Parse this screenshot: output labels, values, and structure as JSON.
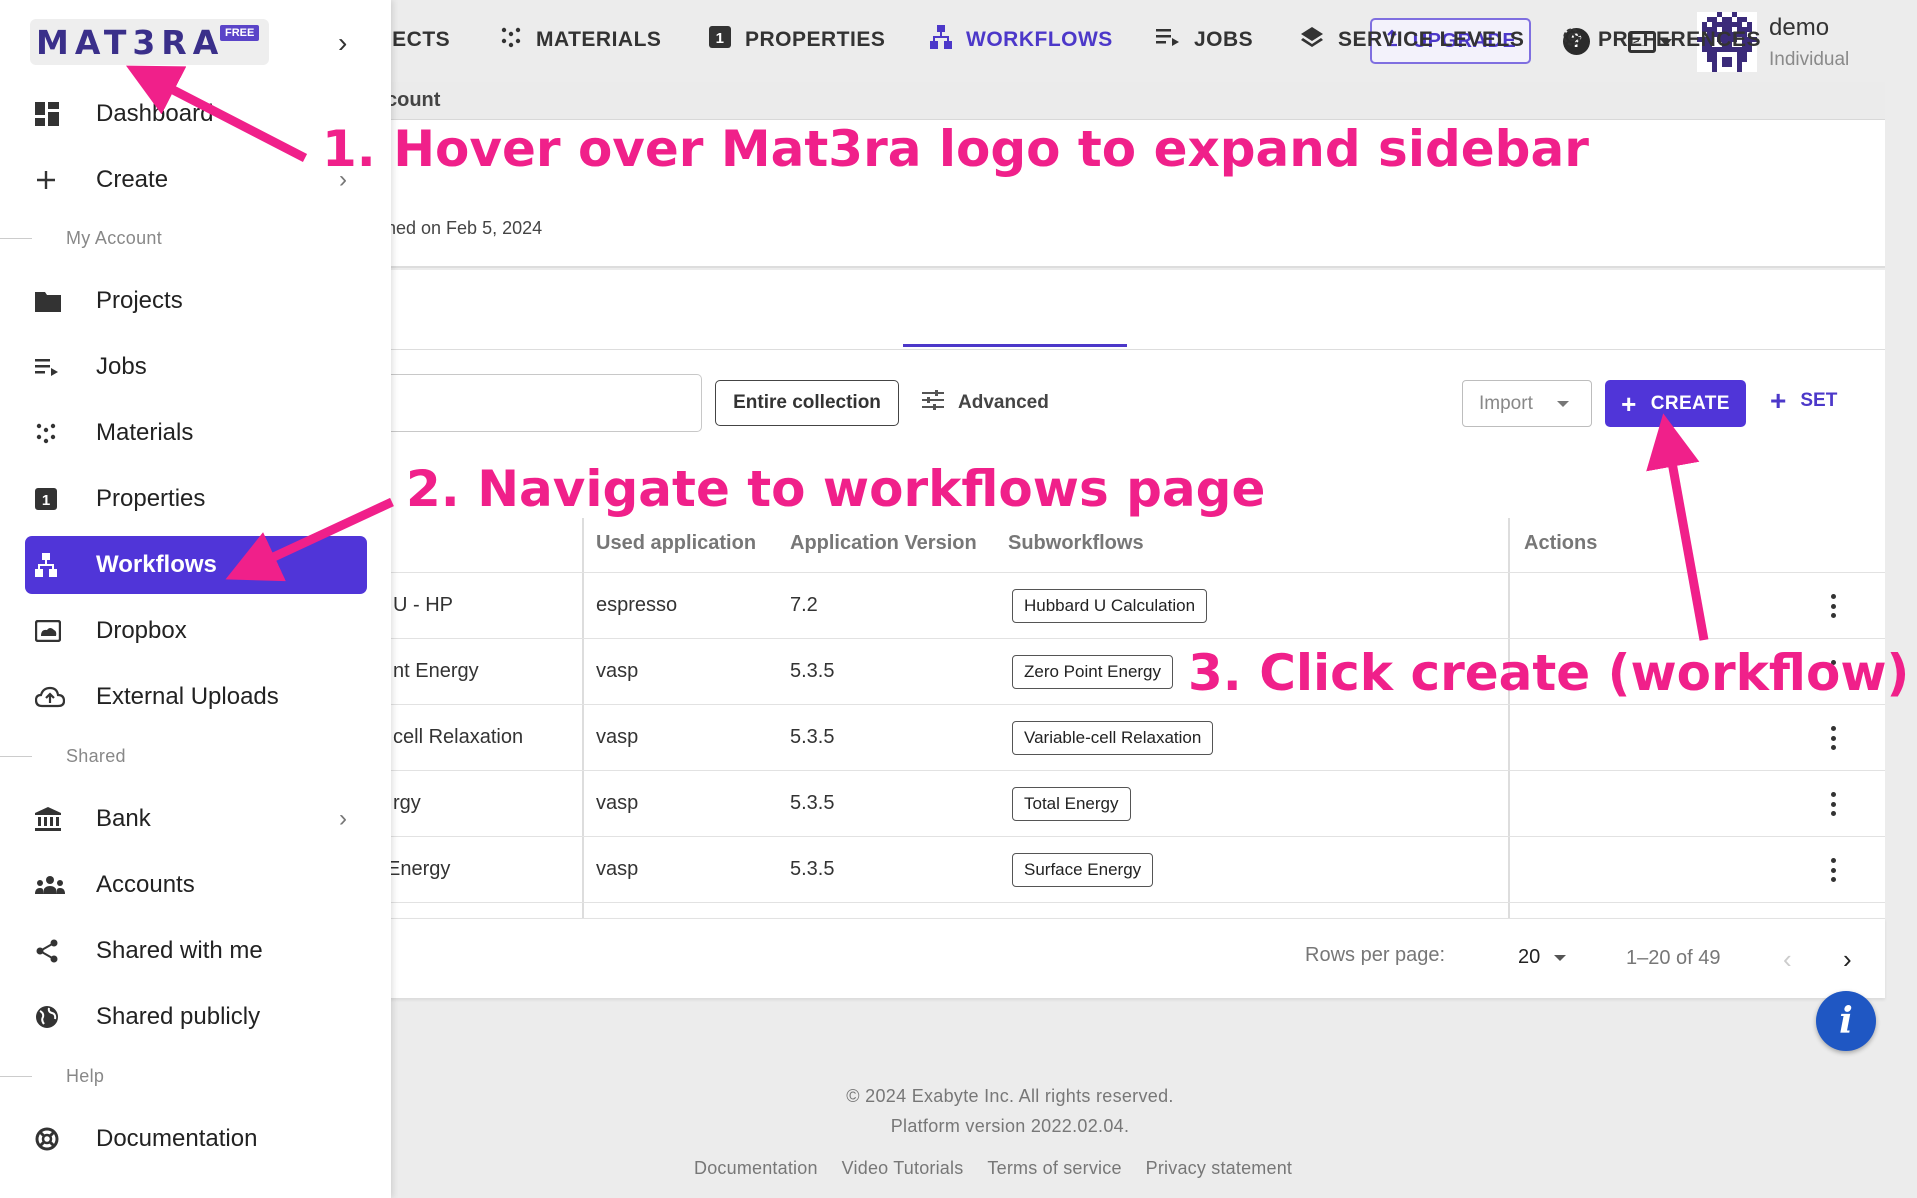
{
  "header": {
    "upgrade_label": "UPGRADE",
    "help_icon": "help-circle-icon",
    "user_name": "demo",
    "user_plan": "Individual"
  },
  "account": {
    "breadcrumb": "count",
    "joined": "ned on Feb 5, 2024"
  },
  "tabs": [
    {
      "label": "JECTS",
      "icon": "folder-icon"
    },
    {
      "label": "MATERIALS",
      "icon": "materials-icon"
    },
    {
      "label": "PROPERTIES",
      "icon": "properties-icon"
    },
    {
      "label": "WORKFLOWS",
      "icon": "workflows-icon",
      "active": true
    },
    {
      "label": "JOBS",
      "icon": "jobs-icon"
    },
    {
      "label": "SERVICE LEVELS",
      "icon": "layers-icon"
    },
    {
      "label": "PREFERENCES",
      "icon": "gear-icon"
    }
  ],
  "toolbar": {
    "search_value": "",
    "entire_collection": "Entire collection",
    "advanced": "Advanced",
    "import": "Import",
    "create": "CREATE",
    "set": "SET"
  },
  "table": {
    "columns": [
      "Used application",
      "Application Version",
      "Subworkflows",
      "Actions"
    ],
    "rows": [
      {
        "name": "U - HP",
        "app": "espresso",
        "version": "7.2",
        "sub": "Hubbard U Calculation"
      },
      {
        "name": "nt Energy",
        "app": "vasp",
        "version": "5.3.5",
        "sub": "Zero Point Energy"
      },
      {
        "name": "cell Relaxation",
        "app": "vasp",
        "version": "5.3.5",
        "sub": "Variable-cell Relaxation"
      },
      {
        "name": "rgy",
        "app": "vasp",
        "version": "5.3.5",
        "sub": "Total Energy"
      },
      {
        "name": "Energy",
        "app": "vasp",
        "version": "5.3.5",
        "sub": "Surface Energy"
      }
    ]
  },
  "pagination": {
    "rows_per_page_label": "Rows per page:",
    "rows_per_page": "20",
    "range": "1–20 of 49"
  },
  "footer": {
    "copyright": "© 2024 Exabyte Inc. All rights reserved.",
    "version": "Platform version 2022.02.04.",
    "links": [
      "Documentation",
      "Video Tutorials",
      "Terms of service",
      "Privacy statement"
    ]
  },
  "sidebar": {
    "logo": "MAT3RA",
    "badge": "FREE",
    "items": [
      {
        "label": "Dashboard",
        "icon": "dashboard-icon"
      },
      {
        "label": "Create",
        "icon": "plus-icon",
        "chevron": true
      }
    ],
    "sections": {
      "account": "My Account",
      "shared": "Shared",
      "help": "Help"
    },
    "account_items": [
      {
        "label": "Projects",
        "icon": "folder-icon"
      },
      {
        "label": "Jobs",
        "icon": "jobs-icon"
      },
      {
        "label": "Materials",
        "icon": "materials-icon"
      },
      {
        "label": "Properties",
        "icon": "properties-icon"
      },
      {
        "label": "Workflows",
        "icon": "workflows-icon",
        "active": true
      },
      {
        "label": "Dropbox",
        "icon": "dropbox-icon"
      },
      {
        "label": "External Uploads",
        "icon": "cloud-upload-icon"
      }
    ],
    "shared_items": [
      {
        "label": "Bank",
        "icon": "bank-icon",
        "chevron": true
      },
      {
        "label": "Accounts",
        "icon": "people-icon"
      },
      {
        "label": "Shared with me",
        "icon": "share-icon"
      },
      {
        "label": "Shared publicly",
        "icon": "globe-icon"
      }
    ],
    "help_items": [
      {
        "label": "Documentation",
        "icon": "lifebuoy-icon"
      }
    ]
  },
  "annotations": {
    "step1": "1. Hover over Mat3ra logo to expand sidebar",
    "step2": "2. Navigate to workflows page",
    "step3": "3. Click create (workflow)",
    "color": "#f0208a"
  },
  "colors": {
    "accent": "#5035d8",
    "info": "#1f57c3"
  }
}
